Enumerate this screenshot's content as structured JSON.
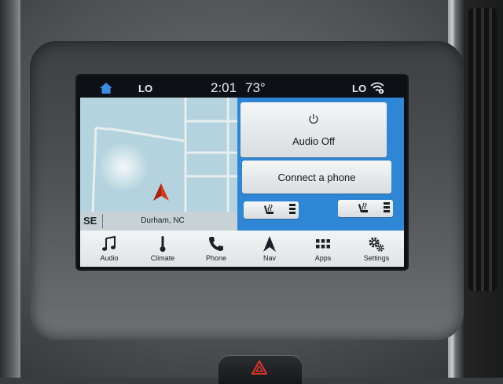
{
  "status_bar": {
    "left_temp_setting": "LO",
    "time": "2:01",
    "outside_temp": "73°",
    "right_temp_setting": "LO",
    "home_icon": "home-icon",
    "wifi_icon": "wifi-icon"
  },
  "map": {
    "compass_heading": "SE",
    "location": "Durham, NC",
    "vehicle_marker": "nav-arrow-icon"
  },
  "controls": {
    "audio_off_label": "Audio Off",
    "power_icon": "power-icon",
    "connect_phone_label": "Connect a phone",
    "seat_heater_icon": "seat-heater-icon"
  },
  "nav": {
    "items": [
      {
        "label": "Audio",
        "icon": "music-note-icon"
      },
      {
        "label": "Climate",
        "icon": "thermometer-icon"
      },
      {
        "label": "Phone",
        "icon": "phone-icon"
      },
      {
        "label": "Nav",
        "icon": "nav-arrow-icon"
      },
      {
        "label": "Apps",
        "icon": "apps-grid-icon"
      },
      {
        "label": "Settings",
        "icon": "gear-icon"
      }
    ]
  },
  "colors": {
    "controls_panel": "#2f86d4",
    "map_water": "#b4d3de",
    "nav_arrow": "#d23a1a",
    "home_icon": "#3d8be0",
    "hazard": "#e0362a"
  }
}
